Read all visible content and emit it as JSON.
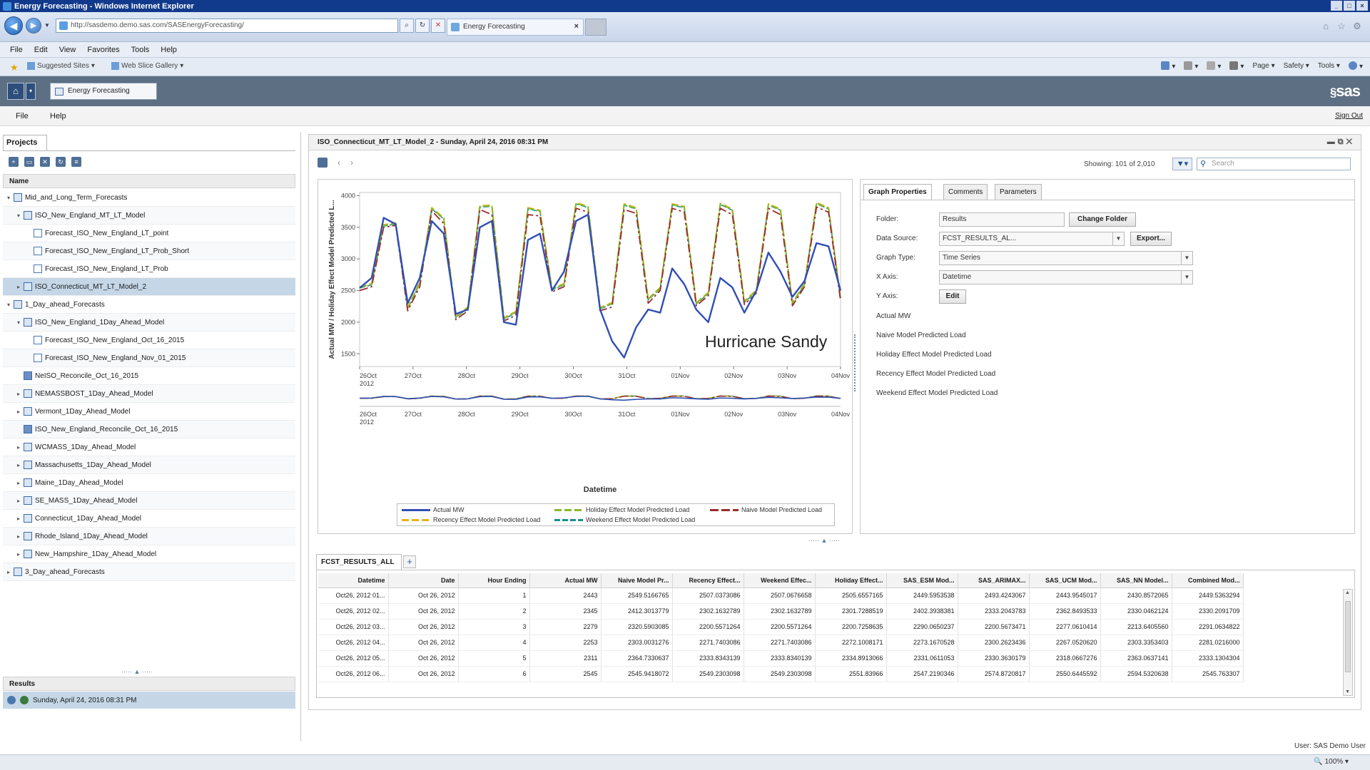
{
  "window": {
    "title": "Energy Forecasting - Windows Internet Explorer",
    "controls": [
      "_",
      "□",
      "×"
    ]
  },
  "browser": {
    "url": "http://sasdemo.demo.sas.com/SASEnergyForecasting/",
    "tab_title": "Energy Forecasting",
    "tab_close": "×",
    "menu": [
      "File",
      "Edit",
      "View",
      "Favorites",
      "Tools",
      "Help"
    ],
    "favorites": [
      "Suggested Sites",
      "Web Slice Gallery"
    ],
    "command_bar": [
      "Page",
      "Safety",
      "Tools"
    ]
  },
  "app": {
    "tab_title": "Energy Forecasting",
    "logo": "sas",
    "menu": [
      "File",
      "Help"
    ],
    "sign_out": "Sign Out"
  },
  "projects": {
    "tab": "Projects",
    "column_header": "Name",
    "items": [
      "Mid_and_Long_Term_Forecasts",
      "ISO_New_England_MT_LT_Model",
      "Forecast_ISO_New_England_LT_point",
      "Forecast_ISO_New_England_LT_Prob_Short",
      "Forecast_ISO_New_England_LT_Prob",
      "ISO_Connecticut_MT_LT_Model_2",
      "1_Day_ahead_Forecasts",
      "ISO_New_England_1Day_Ahead_Model",
      "Forecast_ISO_New_England_Oct_16_2015",
      "Forecast_ISO_New_England_Nov_01_2015",
      "NeISO_Reconcile_Oct_16_2015",
      "NEMASSBOST_1Day_Ahead_Model",
      "Vermont_1Day_Ahead_Model",
      "ISO_New_England_Reconcile_Oct_16_2015",
      "WCMASS_1Day_Ahead_Model",
      "Massachusetts_1Day_Ahead_Model",
      "Maine_1Day_Ahead_Model",
      "SE_MASS_1Day_Ahead_Model",
      "Connecticut_1Day_Ahead_Model",
      "Rhode_Island_1Day_Ahead_Model",
      "New_Hampshire_1Day_Ahead_Model",
      "3_Day_ahead_Forecasts"
    ],
    "results_header": "Results",
    "results_item": "Sunday, April 24, 2016 08:31 PM"
  },
  "main": {
    "title": "ISO_Connecticut_MT_LT_Model_2 - Sunday, April 24, 2016 08:31 PM",
    "showing": "Showing: 101 of 2,010",
    "search_placeholder": "Search",
    "annotation": "Hurricane Sandy"
  },
  "chart_data": {
    "type": "line",
    "title": "",
    "xlabel": "Datetime",
    "ylabel": "Actual MW / Holiday Effect Model Predicted L...",
    "ylim": [
      1300,
      4050
    ],
    "yticks": [
      1500,
      2000,
      2500,
      3000,
      3500,
      4000
    ],
    "xticks": [
      "26Oct 2012",
      "27Oct",
      "28Oct",
      "29Oct",
      "30Oct",
      "31Oct",
      "01Nov",
      "02Nov",
      "03Nov",
      "04Nov"
    ],
    "overview_xticks": [
      "26Oct 2012",
      "27Oct",
      "28Oct",
      "29Oct",
      "30Oct",
      "31Oct",
      "01Nov",
      "02Nov",
      "03Nov",
      "04Nov"
    ],
    "x_hours": [
      0,
      6,
      12,
      18,
      24,
      30,
      36,
      42,
      48,
      54,
      60,
      66,
      72,
      78,
      84,
      90,
      96,
      102,
      108,
      114,
      120,
      126,
      132,
      138,
      144,
      150,
      156,
      162,
      168,
      174,
      180,
      186,
      192,
      198,
      204,
      210,
      216,
      222,
      228,
      234,
      240
    ],
    "series": [
      {
        "name": "Actual MW",
        "color": "#2f4fb5",
        "values": [
          2540,
          2700,
          3650,
          3550,
          2300,
          2700,
          3600,
          3400,
          2130,
          2200,
          3500,
          3600,
          2000,
          1960,
          3300,
          3400,
          2500,
          2800,
          3600,
          3700,
          2200,
          1700,
          1440,
          1920,
          2200,
          2150,
          2850,
          2600,
          2200,
          2000,
          2700,
          2550,
          2150,
          2500,
          3100,
          2800,
          2400,
          2650,
          3250,
          3200,
          2500
        ]
      },
      {
        "name": "Holiday Effect Model Predicted Load",
        "color": "#8ab82a",
        "values": [
          2550,
          2600,
          3530,
          3560,
          2220,
          2620,
          3800,
          3640,
          2080,
          2230,
          3830,
          3840,
          2060,
          2160,
          3800,
          3760,
          2520,
          2600,
          3880,
          3820,
          2220,
          2300,
          3860,
          3800,
          2360,
          2540,
          3860,
          3820,
          2300,
          2460,
          3870,
          3780,
          2320,
          2500,
          3860,
          3780,
          2300,
          2600,
          3880,
          3800,
          2380
        ]
      },
      {
        "name": "Naive Model Predicted Load",
        "color": "#9b2a2a",
        "values": [
          2500,
          2560,
          3500,
          3530,
          2180,
          2560,
          3760,
          3560,
          2040,
          2180,
          3780,
          3700,
          2020,
          2110,
          3700,
          3680,
          2480,
          2560,
          3800,
          3740,
          2180,
          2240,
          3780,
          3720,
          2300,
          2500,
          3800,
          3740,
          2260,
          2420,
          3800,
          3700,
          2280,
          2460,
          3800,
          3700,
          2260,
          2560,
          3820,
          3740,
          2340
        ]
      },
      {
        "name": "Recency Effect Model Predicted Load",
        "color": "#e6b418",
        "values": [
          2560,
          2610,
          3540,
          3570,
          2230,
          2630,
          3810,
          3650,
          2090,
          2240,
          3840,
          3850,
          2070,
          2170,
          3810,
          3770,
          2530,
          2610,
          3890,
          3830,
          2230,
          2310,
          3870,
          3810,
          2370,
          2550,
          3870,
          3830,
          2310,
          2470,
          3880,
          3790,
          2330,
          2510,
          3870,
          3790,
          2310,
          2610,
          3890,
          3810,
          2390
        ]
      },
      {
        "name": "Weekend Effect Model Predicted Load",
        "color": "#1a8f8f",
        "values": [
          2540,
          2590,
          3520,
          3550,
          2210,
          2610,
          3790,
          3630,
          2070,
          2220,
          3820,
          3830,
          2050,
          2150,
          3790,
          3750,
          2510,
          2590,
          3870,
          3810,
          2210,
          2290,
          3850,
          3790,
          2350,
          2530,
          3850,
          3810,
          2290,
          2450,
          3860,
          3770,
          2310,
          2490,
          3850,
          3770,
          2290,
          2590,
          3870,
          3790,
          2370
        ]
      }
    ],
    "legend_placement": "bottom",
    "grid": false
  },
  "properties": {
    "tabs": [
      "Graph Properties",
      "Comments",
      "Parameters"
    ],
    "folder_label": "Folder:",
    "folder_value": "Results",
    "change_folder": "Change Folder",
    "data_source_label": "Data Source:",
    "data_source_value": "FCST_RESULTS_AL...",
    "export": "Export...",
    "graph_type_label": "Graph Type:",
    "graph_type_value": "Time Series",
    "x_axis_label": "X Axis:",
    "x_axis_value": "Datetime",
    "y_axis_label": "Y Axis:",
    "edit": "Edit",
    "y_items": [
      "Actual MW",
      "Naive Model Predicted Load",
      "Holiday Effect Model Predicted Load",
      "Recency Effect Model Predicted Load",
      "Weekend Effect Model Predicted Load"
    ]
  },
  "table": {
    "tab": "FCST_RESULTS_ALL",
    "add": "+",
    "columns": [
      "Datetime",
      "Date",
      "Hour Ending",
      "Actual MW",
      "Naive Model Pr...",
      "Recency Effect...",
      "Weekend Effec...",
      "Holiday Effect...",
      "SAS_ESM Mod...",
      "SAS_ARIMAX...",
      "SAS_UCM Mod...",
      "SAS_NN Model...",
      "Combined Mod..."
    ],
    "rows": [
      [
        "Oct26, 2012 01...",
        "Oct 26, 2012",
        "1",
        "2443",
        "2549.5166765",
        "2507.0373086",
        "2507.0676658",
        "2505.6557165",
        "2449.5953538",
        "2493.4243067",
        "2443.9545017",
        "2430.8572065",
        "2449.5363294"
      ],
      [
        "Oct26, 2012 02...",
        "Oct 26, 2012",
        "2",
        "2345",
        "2412.3013779",
        "2302.1632789",
        "2302.1632789",
        "2301.7288519",
        "2402.3938381",
        "2333.2043783",
        "2362.8493533",
        "2330.0462124",
        "2330.2091709"
      ],
      [
        "Oct26, 2012 03...",
        "Oct 26, 2012",
        "3",
        "2279",
        "2320.5903085",
        "2200.5571264",
        "2200.5571264",
        "2200.7258635",
        "2290.0650237",
        "2200.5673471",
        "2277.0610414",
        "2213.6405560",
        "2291.0634822"
      ],
      [
        "Oct26, 2012 04...",
        "Oct 26, 2012",
        "4",
        "2253",
        "2303.0031276",
        "2271.7403086",
        "2271.7403086",
        "2272.1008171",
        "2273.1670528",
        "2300.2623436",
        "2267.0520620",
        "2303.3353403",
        "2281.0216000"
      ],
      [
        "Oct26, 2012 05...",
        "Oct 26, 2012",
        "5",
        "2311",
        "2364.7330637",
        "2333.8343139",
        "2333.8340139",
        "2334.8913066",
        "2331.0611053",
        "2330.3630179",
        "2318.0667276",
        "2363.0637141",
        "2333.1304304"
      ],
      [
        "Oct26, 2012 06...",
        "Oct 26, 2012",
        "6",
        "2545",
        "2545.9418072",
        "2549.2303098",
        "2549.2303098",
        "2551.83966",
        "2547.2190346",
        "2574.8720817",
        "2550.6445592",
        "2594.5320638",
        "2545.763307"
      ]
    ]
  },
  "footer": {
    "user": "User: SAS Demo User",
    "zoom": "100%"
  }
}
